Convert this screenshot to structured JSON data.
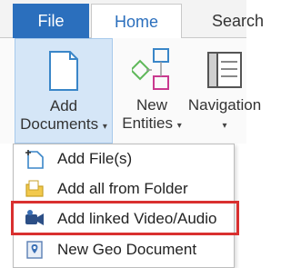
{
  "tabs": {
    "file": "File",
    "home": "Home",
    "search": "Search"
  },
  "ribbon": {
    "add_documents": {
      "line1": "Add",
      "line2": "Documents",
      "icon": "document-icon"
    },
    "new_entities": {
      "line1": "New",
      "line2": "Entities",
      "icon": "entities-icon"
    },
    "navigation": {
      "line1": "Navigation",
      "icon": "navigation-pane-icon"
    }
  },
  "menu": {
    "items": [
      {
        "label": "Add File(s)",
        "icon": "add-file-icon"
      },
      {
        "label": "Add all from Folder",
        "icon": "folder-icon"
      },
      {
        "label": "Add linked Video/Audio",
        "icon": "video-audio-icon"
      },
      {
        "label": "New Geo Document",
        "icon": "geo-document-icon"
      }
    ]
  },
  "colors": {
    "file_tab": "#2b6fbd",
    "selected_button": "#d5e6f7",
    "highlight": "#d9302f"
  }
}
